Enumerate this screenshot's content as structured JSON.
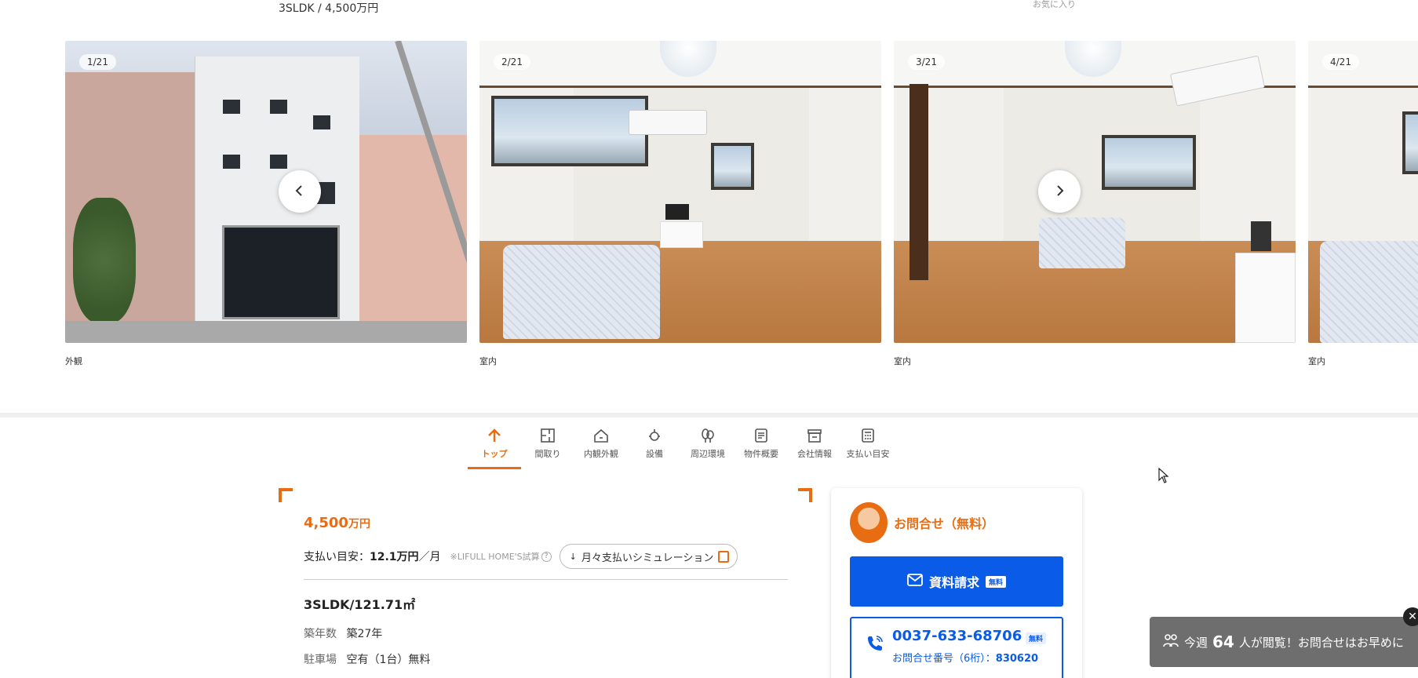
{
  "header": {
    "summary": "3SLDK / 4,500万円",
    "favorite_label": "お気に入り"
  },
  "gallery": {
    "slides": [
      {
        "counter": "1/21",
        "caption": "外観"
      },
      {
        "counter": "2/21",
        "caption": "室内"
      },
      {
        "counter": "3/21",
        "caption": "室内"
      },
      {
        "counter": "4/21",
        "caption": "室内"
      }
    ],
    "prev_icon": "chevron-left-icon",
    "next_icon": "chevron-right-icon"
  },
  "tabs": [
    {
      "label": "トップ",
      "icon": "arrow-up-icon",
      "active": true
    },
    {
      "label": "間取り",
      "icon": "floorplan-icon"
    },
    {
      "label": "内観外観",
      "icon": "house-icon"
    },
    {
      "label": "設備",
      "icon": "faucet-icon"
    },
    {
      "label": "周辺環境",
      "icon": "tree-icon"
    },
    {
      "label": "物件概要",
      "icon": "document-icon"
    },
    {
      "label": "会社情報",
      "icon": "store-icon"
    },
    {
      "label": "支払い目安",
      "icon": "calculator-icon"
    }
  ],
  "property": {
    "price_number": "4,500",
    "price_unit": "万円",
    "payment_label": "支払い目安：",
    "payment_value": "12.1万円",
    "payment_unit": "／月",
    "payment_note": "※LIFULL HOME'S試算",
    "simulation_button": "月々支払いシミュレーション",
    "layout_size": "3SLDK/121.71㎡",
    "specs": [
      {
        "key": "築年数",
        "value": "築27年"
      },
      {
        "key": "駐車場",
        "value": "空有（1台）無料"
      }
    ]
  },
  "contact": {
    "title": "お問合せ（無料）",
    "request_button": "資料請求",
    "free_badge": "無料",
    "phone": "0037-633-68706",
    "phone_free_badge": "無料",
    "inquiry_label": "お問合せ番号（6桁）：",
    "inquiry_number": "830620"
  },
  "banner": {
    "prefix": "今週",
    "count": "64",
    "suffix": "人が閲覧！お問合せはお早めに"
  },
  "colors": {
    "accent": "#e86d12",
    "primary": "#0a5be8",
    "banner_bg": "#6e6e6e"
  }
}
